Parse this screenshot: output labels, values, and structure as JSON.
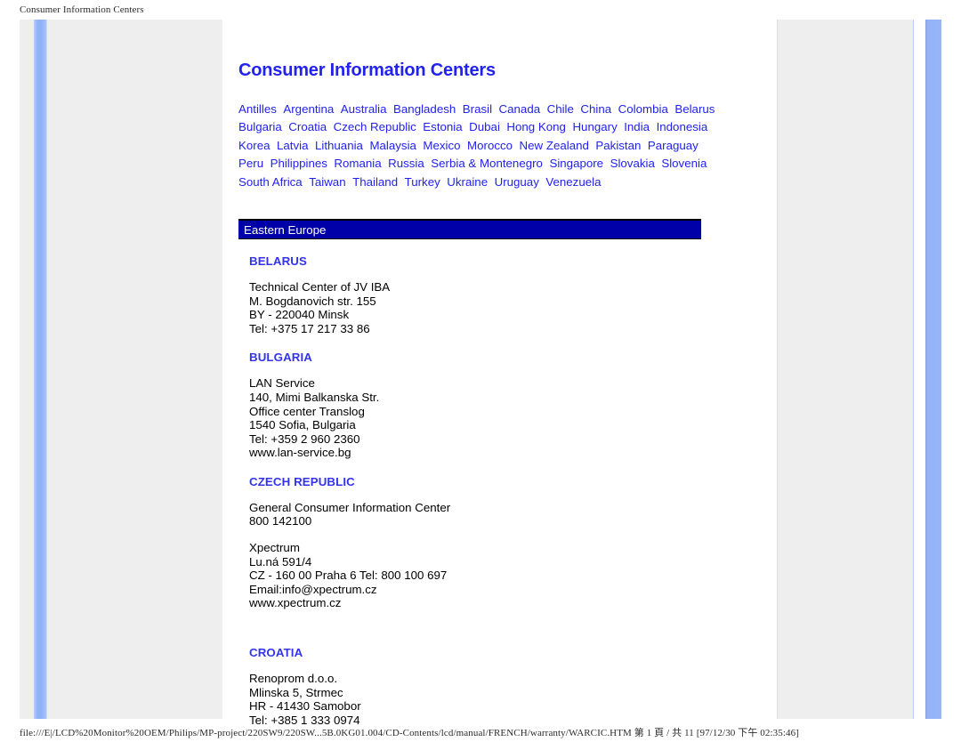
{
  "browser": {
    "header_title": "Consumer Information Centers",
    "footer_path": "file:///E|/LCD%20Monitor%20OEM/Philips/MP-project/220SW9/220SW...5B.0KG01.004/CD-Contents/lcd/manual/FRENCH/warranty/WARCIC.HTM 第 1 頁 / 共 11  [97/12/30 下午 02:35:46]"
  },
  "colors": {
    "link": "#2222ee",
    "heading": "#3333ee",
    "banner_bg": "#0000a8",
    "banner_text": "#ffffff",
    "rail_bg": "#eeeeee",
    "accent_blue": "#93b3f7"
  },
  "document": {
    "title": "Consumer Information Centers",
    "country_link_rows": [
      [
        "Antilles",
        "Argentina",
        "Australia",
        "Bangladesh",
        "Brasil",
        "Canada",
        "Chile",
        "China",
        "Colombia",
        "Belarus"
      ],
      [
        "Bulgaria",
        "Croatia",
        "Czech Republic",
        "Estonia",
        "Dubai",
        "Hong Kong",
        "Hungary",
        "India",
        "Indonesia"
      ],
      [
        "Korea",
        "Latvia",
        "Lithuania",
        "Malaysia",
        "Mexico",
        "Morocco",
        "New Zealand",
        "Pakistan",
        "Paraguay"
      ],
      [
        "Peru",
        "Philippines",
        "Romania",
        "Russia",
        "Serbia & Montenegro",
        "Singapore",
        "Slovakia",
        "Slovenia"
      ],
      [
        "South Africa",
        "Taiwan",
        "Thailand",
        "Turkey",
        "Ukraine",
        "Uruguay",
        "Venezuela"
      ]
    ],
    "region_banner": "Eastern Europe",
    "entries": [
      {
        "country": "BELARUS",
        "blocks": [
          [
            "Technical Center of JV IBA",
            "M. Bogdanovich str. 155",
            "BY - 220040 Minsk",
            "Tel: +375 17 217 33 86"
          ]
        ]
      },
      {
        "country": "BULGARIA",
        "blocks": [
          [
            "LAN Service",
            "140, Mimi Balkanska Str.",
            "Office center Translog",
            "1540 Sofia, Bulgaria",
            "Tel: +359 2 960 2360",
            "www.lan-service.bg"
          ]
        ]
      },
      {
        "country": "CZECH REPUBLIC",
        "blocks": [
          [
            "General Consumer Information Center",
            "800 142100"
          ],
          [
            "Xpectrum",
            "Lu.ná 591/4",
            "CZ - 160 00 Praha 6 Tel: 800 100 697",
            "Email:info@xpectrum.cz",
            "www.xpectrum.cz"
          ]
        ]
      },
      {
        "country": "CROATIA",
        "blocks": [
          [
            "Renoprom d.o.o.",
            "Mlinska 5, Strmec",
            "HR - 41430 Samobor",
            "Tel: +385 1 333 0974"
          ]
        ]
      }
    ]
  }
}
